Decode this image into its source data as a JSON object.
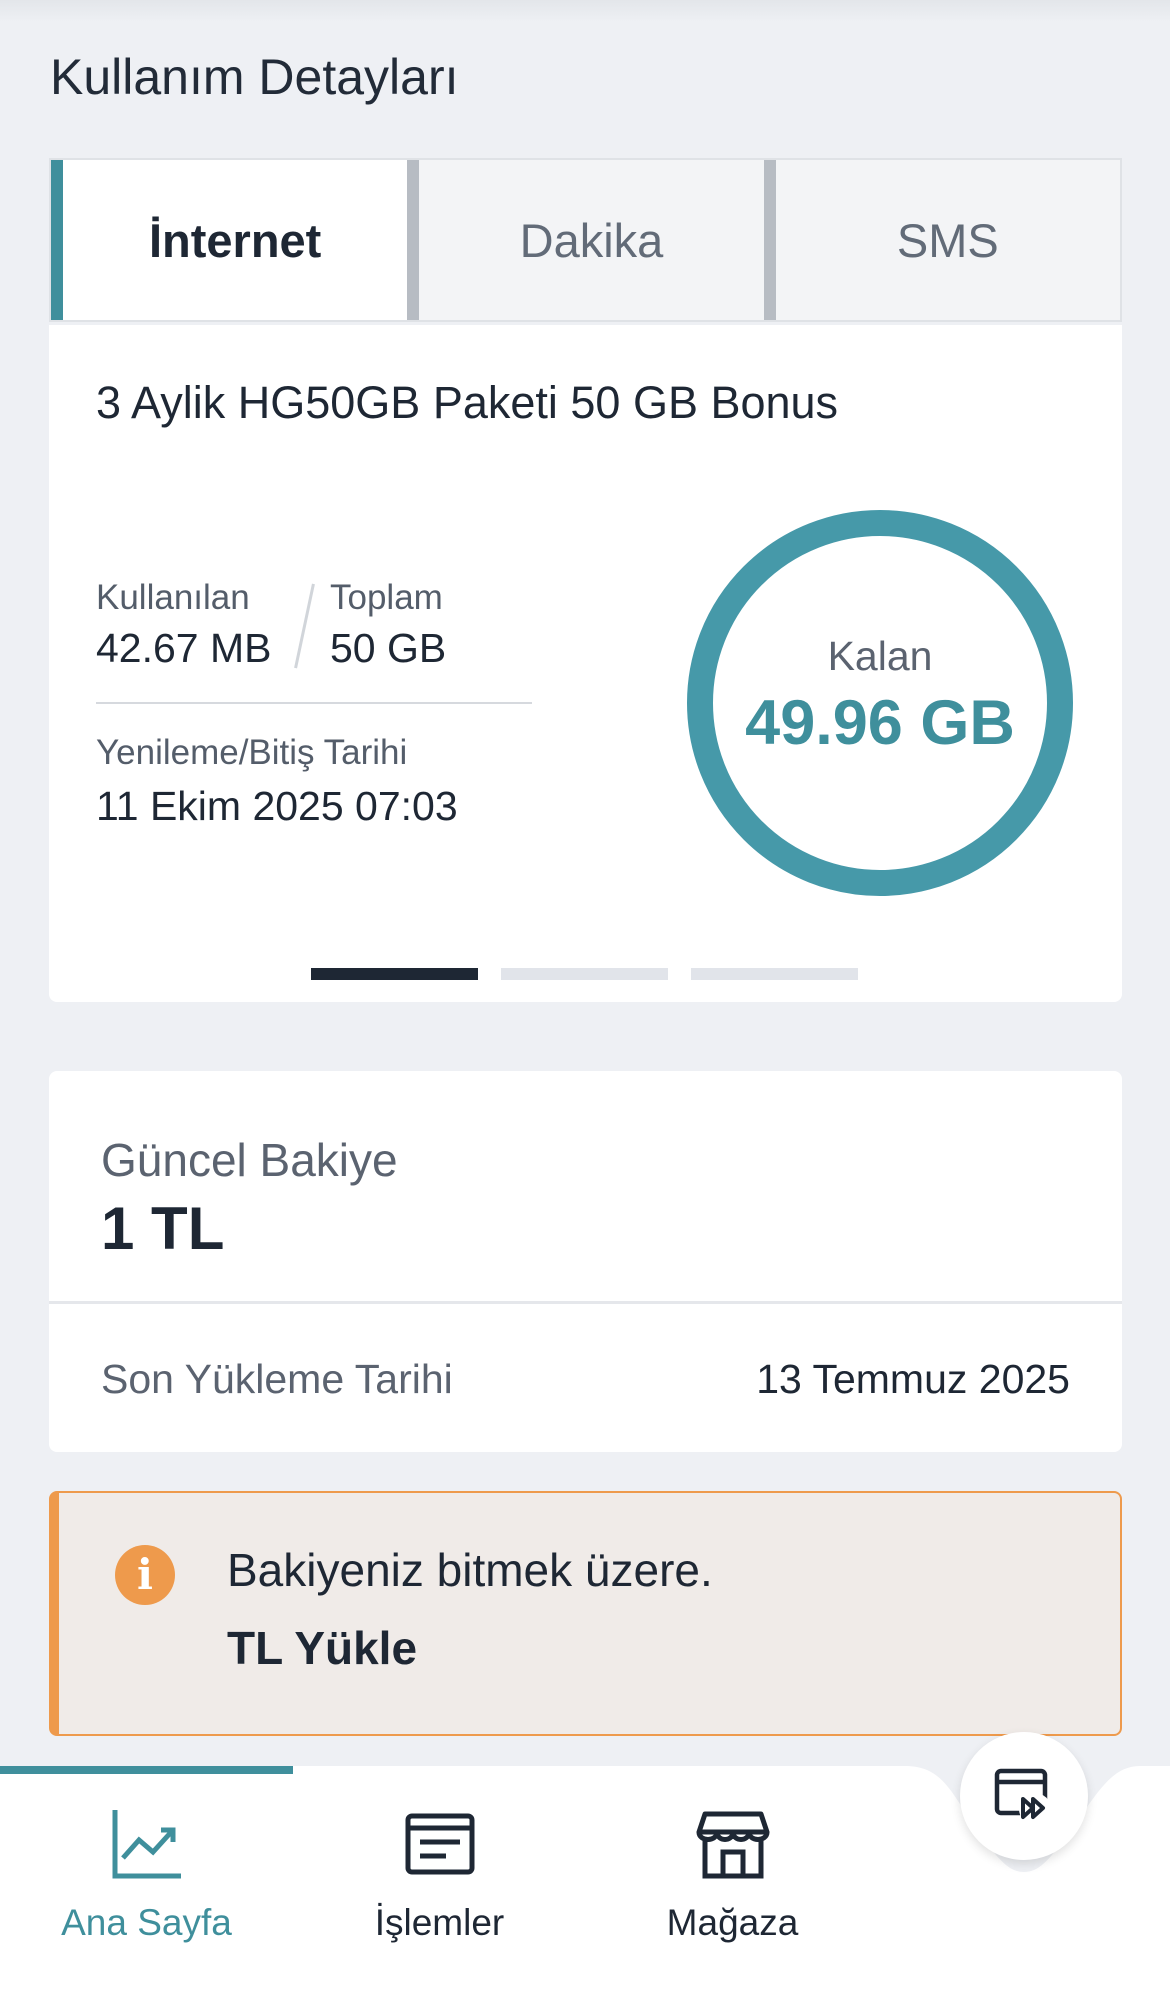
{
  "header": {
    "title": "Kullanım Detayları"
  },
  "tabs": [
    {
      "label": "İnternet",
      "active": true
    },
    {
      "label": "Dakika",
      "active": false
    },
    {
      "label": "SMS",
      "active": false
    }
  ],
  "usage": {
    "package_name": "3 Aylik HG50GB Paketi 50 GB Bonus",
    "used_label": "Kullanılan",
    "used_value": "42.67 MB",
    "total_label": "Toplam",
    "total_value": "50 GB",
    "renewal_label": "Yenileme/Bitiş Tarihi",
    "renewal_value": "11 Ekim 2025 07:03",
    "remaining_label": "Kalan",
    "remaining_value": "49.96 GB",
    "page_indicator": {
      "count": 3,
      "active_index": 0
    }
  },
  "balance": {
    "label": "Güncel Bakiye",
    "value": "1 TL",
    "last_load_label": "Son Yükleme Tarihi",
    "last_load_value": "13 Temmuz 2025"
  },
  "alert": {
    "icon": "info-icon",
    "message": "Bakiyeniz bitmek üzere.",
    "action_label": "TL Yükle"
  },
  "bottom_nav": {
    "items": [
      {
        "label": "Ana Sayfa",
        "icon": "chart-icon",
        "active": true
      },
      {
        "label": "İşlemler",
        "icon": "document-icon",
        "active": false
      },
      {
        "label": "Mağaza",
        "icon": "store-icon",
        "active": false
      }
    ],
    "fab_icon": "media-forward-icon"
  },
  "colors": {
    "accent": "#3f8f9c",
    "ring": "#4699a9",
    "warning": "#ee9a4c",
    "dark": "#1e2734"
  }
}
